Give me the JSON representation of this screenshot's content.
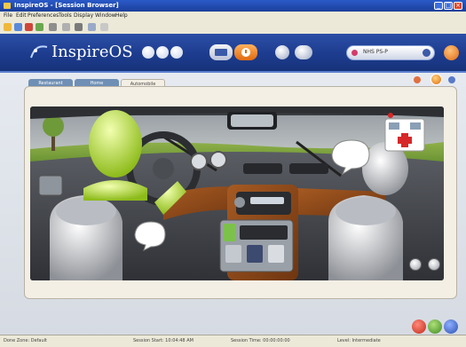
{
  "window": {
    "title": "InspireOS - [Session Browser]",
    "controls": [
      "minimize",
      "maximize",
      "close"
    ]
  },
  "menubar": {
    "items": [
      "File",
      "Edit",
      "Preferences",
      "Tools",
      "Display",
      "Window",
      "Help"
    ]
  },
  "toolbar": {
    "icons": [
      "back-icon",
      "forward-icon",
      "stop-icon",
      "refresh-icon",
      "home-icon",
      "print-icon",
      "settings-icon"
    ]
  },
  "app": {
    "logo_mark": "Lifecare",
    "name": "InspireOS",
    "search_value": "NHS PS-P"
  },
  "tabs": [
    {
      "label": "Restaurant",
      "active": false
    },
    {
      "label": "Home",
      "active": false
    },
    {
      "label": "Automobile",
      "active": true
    }
  ],
  "statusbar": {
    "fields": [
      "Done Zone: Default",
      "Session Start: 10:04:48 AM",
      "Session Time: 00:00:00:00",
      "Level: Intermediate"
    ]
  },
  "colors": {
    "header_blue": "#1d3c8f",
    "accent_orange": "#f08020",
    "panel_bg": "#f4efe4",
    "dashboard_brown": "#8a4a1c"
  }
}
